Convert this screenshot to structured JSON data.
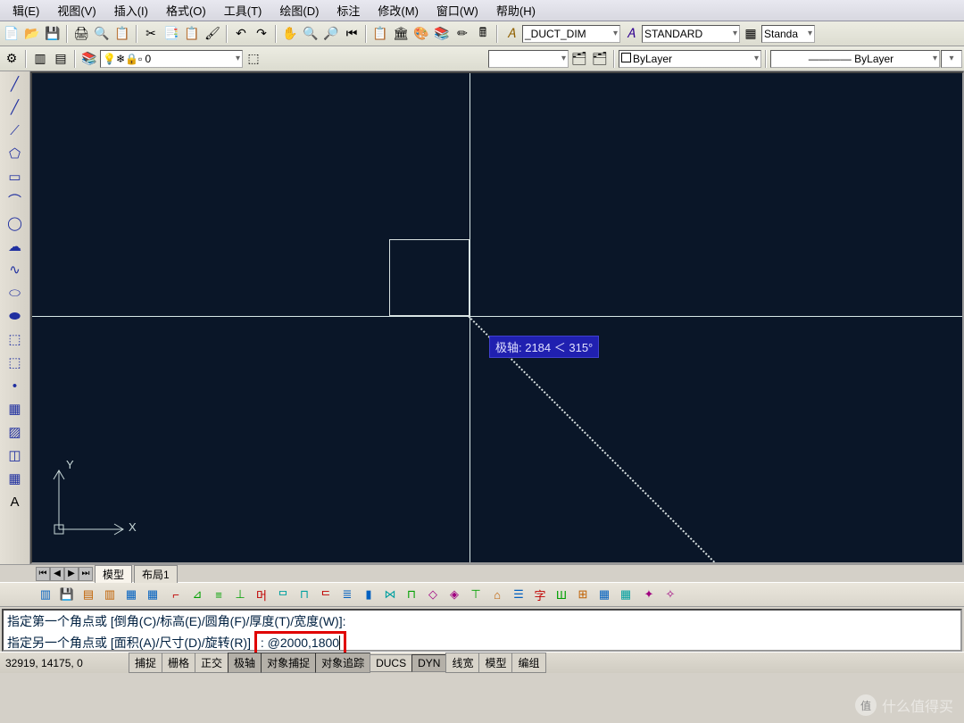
{
  "menu": {
    "items": [
      "辑(E)",
      "视图(V)",
      "插入(I)",
      "格式(O)",
      "工具(T)",
      "绘图(D)",
      "标注",
      "修改(M)",
      "窗口(W)",
      "帮助(H)"
    ]
  },
  "style_bar": {
    "dim_style": "_DUCT_DIM",
    "text_style": "STANDARD",
    "table_style": "Standa"
  },
  "layer_bar": {
    "layer_name": "0",
    "color_label": "ByLayer",
    "linetype_label": "ByLayer"
  },
  "tabs": {
    "model": "模型",
    "layout1": "布局1"
  },
  "tooltip": {
    "polar": "极轴: 2184 ＜ 315°"
  },
  "ucs": {
    "x": "X",
    "y": "Y"
  },
  "command": {
    "line1": "指定第一个角点或 [倒角(C)/标高(E)/圆角(F)/厚度(T)/宽度(W)]:",
    "line2_prefix": "指定另一个角点或 [面积(A)/尺寸(D)/旋转(R)]",
    "prompt": ": ",
    "input": "@2000,1800"
  },
  "statusbar": {
    "coords": "32919, 14175, 0",
    "snaps": [
      "捕捉",
      "栅格",
      "正交",
      "极轴",
      "对象捕捉",
      "对象追踪",
      "DUCS",
      "DYN",
      "线宽",
      "模型",
      "编组"
    ],
    "pressed": [
      false,
      false,
      false,
      true,
      true,
      true,
      false,
      true,
      false,
      false,
      false
    ]
  },
  "watermark": {
    "logo": "值",
    "text": "什么值得买"
  }
}
